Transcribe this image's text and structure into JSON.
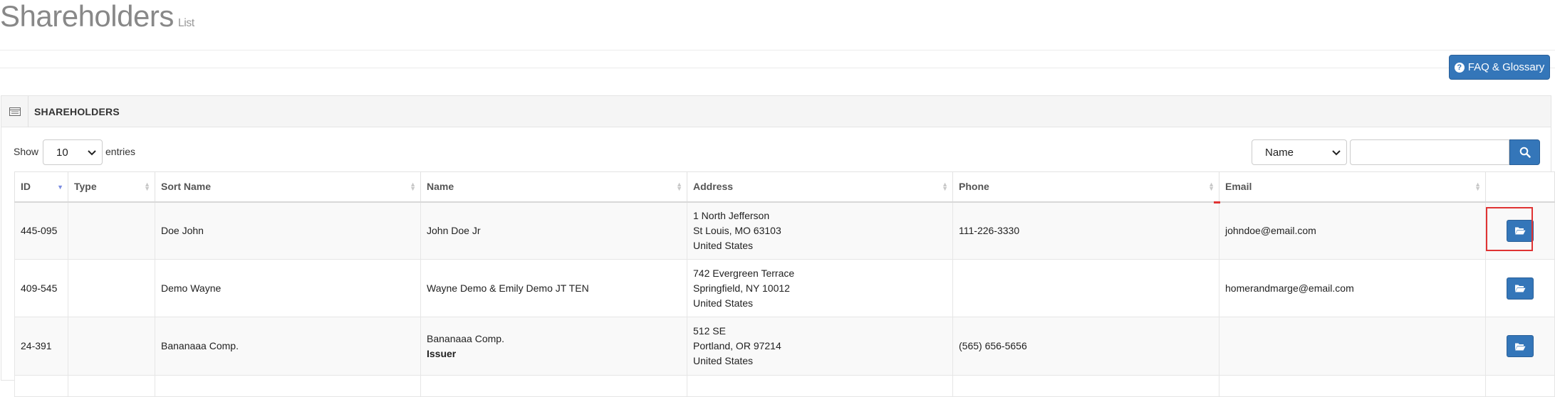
{
  "page": {
    "title": "Shareholders",
    "subtitle": "List"
  },
  "toolbar": {
    "faq_label": "FAQ & Glossary",
    "faq_icon": "question-circle-icon"
  },
  "portlet": {
    "title": "SHAREHOLDERS",
    "icon": "table-icon"
  },
  "controls": {
    "show_label": "Show",
    "entries_value": "10",
    "entries_label": "entries",
    "filter_value": "Name",
    "search_value": "",
    "search_icon": "search-icon"
  },
  "table": {
    "columns": [
      "ID",
      "Type",
      "Sort Name",
      "Name",
      "Address",
      "Phone",
      "Email",
      ""
    ],
    "rows": [
      {
        "id": "445-095",
        "type": "",
        "sort_name": "Doe John",
        "name": "John Doe Jr",
        "name_tag": "",
        "address": [
          "1 North Jefferson",
          "St Louis, MO 63103",
          "United States"
        ],
        "phone": "111-226-3330",
        "email": "johndoe@email.com"
      },
      {
        "id": "409-545",
        "type": "",
        "sort_name": "Demo Wayne",
        "name": "Wayne Demo & Emily Demo JT TEN",
        "name_tag": "",
        "address": [
          "742 Evergreen Terrace",
          "Springfield, NY 10012",
          "United States"
        ],
        "phone": "",
        "email": "homerandmarge@email.com"
      },
      {
        "id": "24-391",
        "type": "",
        "sort_name": "Bananaaa Comp.",
        "name": "Bananaaa Comp.",
        "name_tag": "Issuer",
        "address": [
          "512 SE",
          "Portland, OR 97214",
          "United States"
        ],
        "phone": "(565) 656-5656",
        "email": ""
      }
    ]
  },
  "colors": {
    "accent": "#3476b9",
    "highlight": "#e03333"
  }
}
